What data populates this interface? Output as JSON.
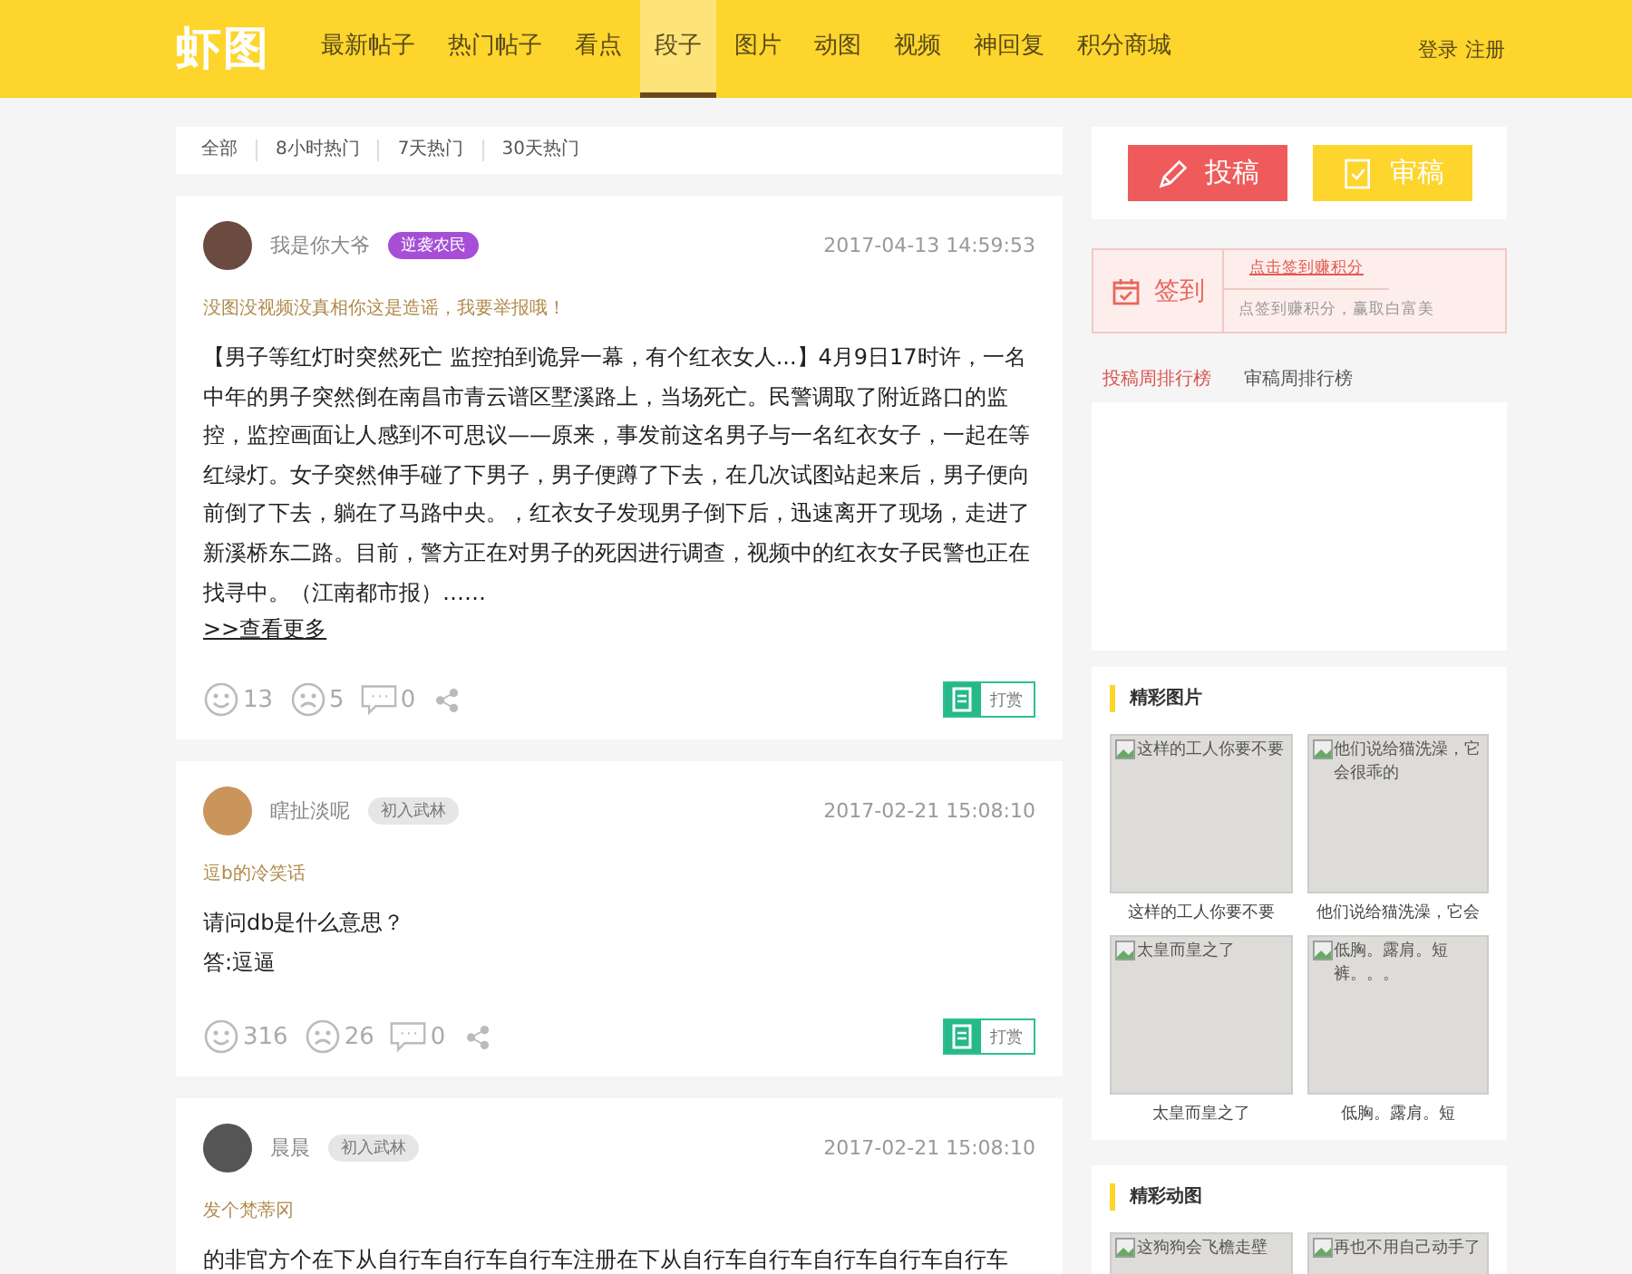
{
  "header": {
    "logo": "虾图",
    "nav": [
      {
        "label": "最新帖子",
        "selected": false
      },
      {
        "label": "热门帖子",
        "selected": false
      },
      {
        "label": "看点",
        "selected": false
      },
      {
        "label": "段子",
        "selected": true
      },
      {
        "label": "图片",
        "selected": false
      },
      {
        "label": "动图",
        "selected": false
      },
      {
        "label": "视频",
        "selected": false
      },
      {
        "label": "神回复",
        "selected": false
      },
      {
        "label": "积分商城",
        "selected": false
      }
    ],
    "login": "登录",
    "register": "注册"
  },
  "filters": [
    "全部",
    "8小时热门",
    "7天热门",
    "30天热门"
  ],
  "posts": [
    {
      "user": "我是你大爷",
      "badge": {
        "label": "逆袭农民",
        "kind": "vip"
      },
      "time": "2017-04-13 14:59:53",
      "title": "没图没视频没真相你这是造谣，我要举报哦！",
      "body": [
        "【男子等红灯时突然死亡 监控拍到诡异一幕，有个红衣女人...】4月9日17时许，一名中年的男子突然倒在南昌市青云谱区墅溪路上，当场死亡。民警调取了附近路口的监控，监控画面让人感到不可思议——原来，事发前这名男子与一名红衣女子，一起在等红绿灯。女子突然伸手碰了下男子，男子便蹲了下去，在几次试图站起来后，男子便向前倒了下去，躺在了马路中央。，红衣女子发现男子倒下后，迅速离开了现场，走进了新溪桥东二路。目前，警方正在对男子的死因进行调查，视频中的红衣女子民警也正在找寻中。（江南都市报）……"
      ],
      "more": ">>查看更多",
      "likes": "13",
      "dislikes": "5",
      "comments": "0",
      "reward": "打赏"
    },
    {
      "user": "瞎扯淡呢",
      "badge": {
        "label": "初入武林",
        "kind": "basic"
      },
      "time": "2017-02-21 15:08:10",
      "title": "逗b的冷笑话",
      "body": [
        "请问db是什么意思？",
        "答:逗逼"
      ],
      "likes": "316",
      "dislikes": "26",
      "comments": "0",
      "reward": "打赏"
    },
    {
      "user": "晨晨",
      "badge": {
        "label": "初入武林",
        "kind": "basic"
      },
      "time": "2017-02-21 15:08:10",
      "title": "发个梵蒂冈",
      "body": [
        "的非官方个在下从自行车自行车自行车注册在下从自行车自行车自行车自行车自行车"
      ]
    }
  ],
  "actions": {
    "submit": "投稿",
    "review": "审稿"
  },
  "signin": {
    "label": "签到",
    "link": "点击签到赚积分",
    "hint": "点签到赚积分，赢取白富美"
  },
  "rank_tabs": [
    {
      "label": "投稿周排行榜",
      "selected": true
    },
    {
      "label": "审稿周排行榜",
      "selected": false
    }
  ],
  "galleries": [
    {
      "title": "精彩图片",
      "items": [
        {
          "alt": "这样的工人你要不要",
          "caption": "这样的工人你要不要"
        },
        {
          "alt": "他们说给猫洗澡，它会很乖的",
          "caption": "他们说给猫洗澡，它会"
        },
        {
          "alt": "太皇而皇之了",
          "caption": "太皇而皇之了"
        },
        {
          "alt": "低胸。露肩。短裤。。。",
          "caption": "低胸。露肩。短"
        }
      ]
    },
    {
      "title": "精彩动图",
      "items": [
        {
          "alt": "这狗狗会飞檐走壁"
        },
        {
          "alt": "再也不用自己动手了"
        }
      ]
    }
  ]
}
